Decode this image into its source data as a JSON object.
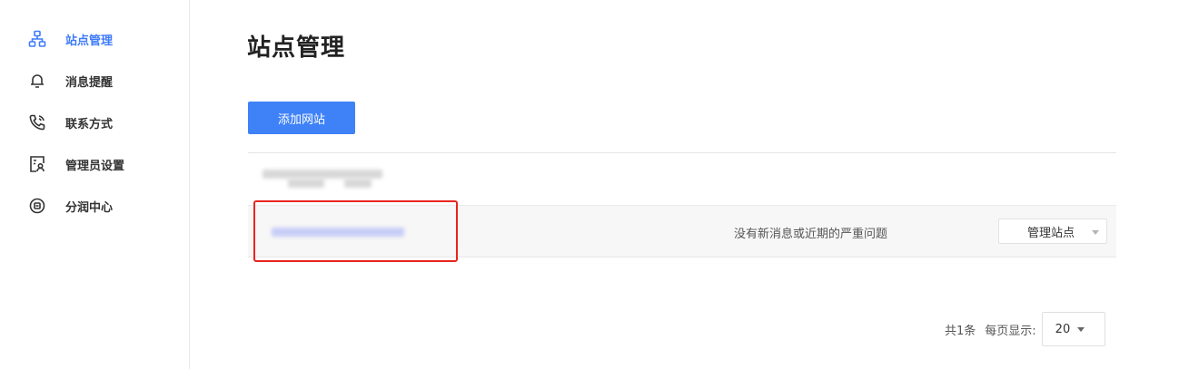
{
  "sidebar": {
    "items": [
      {
        "label": "站点管理",
        "icon": "site-structure-icon",
        "active": true
      },
      {
        "label": "消息提醒",
        "icon": "bell-icon",
        "active": false
      },
      {
        "label": "联系方式",
        "icon": "phone-icon",
        "active": false
      },
      {
        "label": "管理员设置",
        "icon": "admin-user-icon",
        "active": false
      },
      {
        "label": "分润中心",
        "icon": "revenue-share-icon",
        "active": false
      }
    ]
  },
  "main": {
    "title": "站点管理",
    "add_button_label": "添加网站",
    "sites": [
      {
        "status": "没有新消息或近期的严重问题",
        "manage_label": "管理站点"
      }
    ]
  },
  "pagination": {
    "total_text": "共1条",
    "per_page_label": "每页显示:",
    "per_page_value": "20"
  },
  "colors": {
    "accent": "#3e7bfa",
    "button": "#3f82f8",
    "highlight": "#e8251f"
  }
}
